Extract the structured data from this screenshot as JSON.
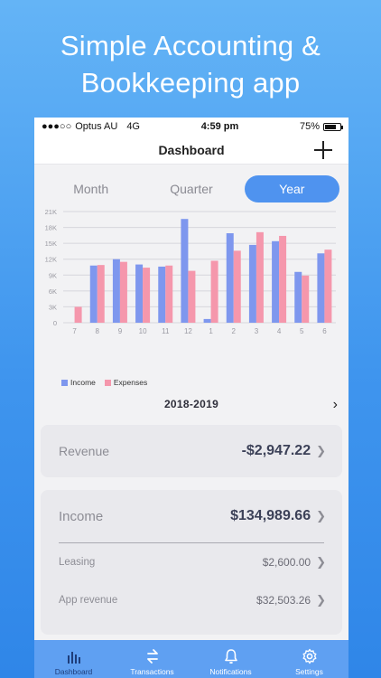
{
  "promo": {
    "line1": "Simple Accounting &",
    "line2": "Bookkeeping app"
  },
  "status_bar": {
    "carrier": "Optus AU",
    "network": "4G",
    "time": "4:59 pm",
    "battery": "75%",
    "battery_level": 0.75
  },
  "header": {
    "title": "Dashboard",
    "add_icon": "plus-icon"
  },
  "period_tabs": [
    {
      "label": "Month",
      "active": false
    },
    {
      "label": "Quarter",
      "active": false
    },
    {
      "label": "Year",
      "active": true
    }
  ],
  "chart_data": {
    "type": "bar",
    "categories": [
      "7",
      "8",
      "9",
      "10",
      "11",
      "12",
      "1",
      "2",
      "3",
      "4",
      "5",
      "6"
    ],
    "ylim": [
      0,
      21000
    ],
    "yticks": [
      "0",
      "3K",
      "6K",
      "9K",
      "12K",
      "15K",
      "18K",
      "21K"
    ],
    "ytick_values": [
      0,
      3000,
      6000,
      9000,
      12000,
      15000,
      18000,
      21000
    ],
    "grid": true,
    "legend_position": "bottom-left",
    "series": [
      {
        "name": "Income",
        "color": "#7e97ee",
        "values": [
          0,
          10800,
          12000,
          11000,
          10600,
          19600,
          700,
          16900,
          14700,
          15400,
          9600,
          13100
        ]
      },
      {
        "name": "Expenses",
        "color": "#f597ac",
        "values": [
          3000,
          10900,
          11500,
          10400,
          10800,
          9800,
          11700,
          13600,
          17100,
          16400,
          8900,
          13800
        ]
      }
    ]
  },
  "period_nav": {
    "label": "2018-2019",
    "next_icon": "chevron-right-icon"
  },
  "revenue_card": {
    "label": "Revenue",
    "value": "-$2,947.22"
  },
  "income_card": {
    "label": "Income",
    "value": "$134,989.66",
    "items": [
      {
        "label": "Leasing",
        "value": "$2,600.00"
      },
      {
        "label": "App revenue",
        "value": "$32,503.26"
      }
    ]
  },
  "tab_bar": [
    {
      "label": "Dashboard",
      "icon": "bar-chart-icon",
      "active": true
    },
    {
      "label": "Transactions",
      "icon": "transfer-arrows-icon",
      "active": false
    },
    {
      "label": "Notifications",
      "icon": "bell-icon",
      "active": false
    },
    {
      "label": "Settings",
      "icon": "gear-icon",
      "active": false
    }
  ]
}
